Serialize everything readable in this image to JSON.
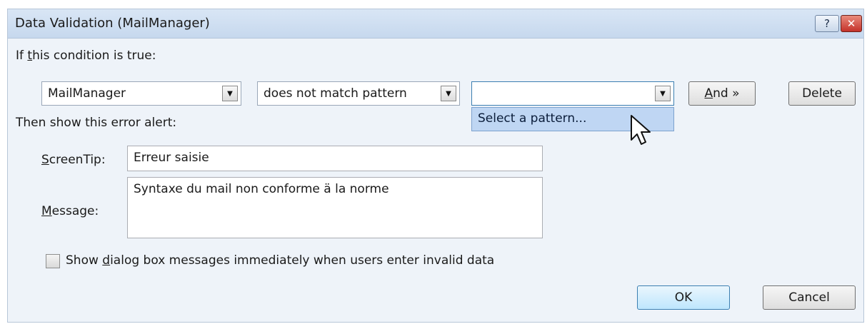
{
  "window": {
    "title": "Data Validation (MailManager)",
    "help_icon": "?",
    "close_icon": "✕"
  },
  "condition": {
    "heading_prefix": "If ",
    "heading_mnemonic": "t",
    "heading_rest": "his condition is true:",
    "field_value": "MailManager",
    "operator_value": "does not match pattern",
    "pattern_value": "",
    "dropdown_item": "Select a pattern...",
    "and_button_mnemonic": "A",
    "and_button_rest": "nd »",
    "delete_button": "Delete"
  },
  "alert": {
    "heading": "Then show this error alert:",
    "screentip_mnemonic": "S",
    "screentip_rest": "creenTip:",
    "screentip_value": "Erreur saisie",
    "message_mnemonic": "M",
    "message_rest": "essage:",
    "message_value": "Syntaxe du mail non conforme ä la norme"
  },
  "options": {
    "show_immediately_checked": false,
    "show_immediately_prefix": "Show ",
    "show_immediately_mnemonic": "d",
    "show_immediately_rest": "ialog box messages immediately when users enter invalid data"
  },
  "footer": {
    "ok": "OK",
    "cancel": "Cancel"
  },
  "icons": {
    "dropdown_arrow": "▼",
    "cursor": "arrow-pointer"
  }
}
